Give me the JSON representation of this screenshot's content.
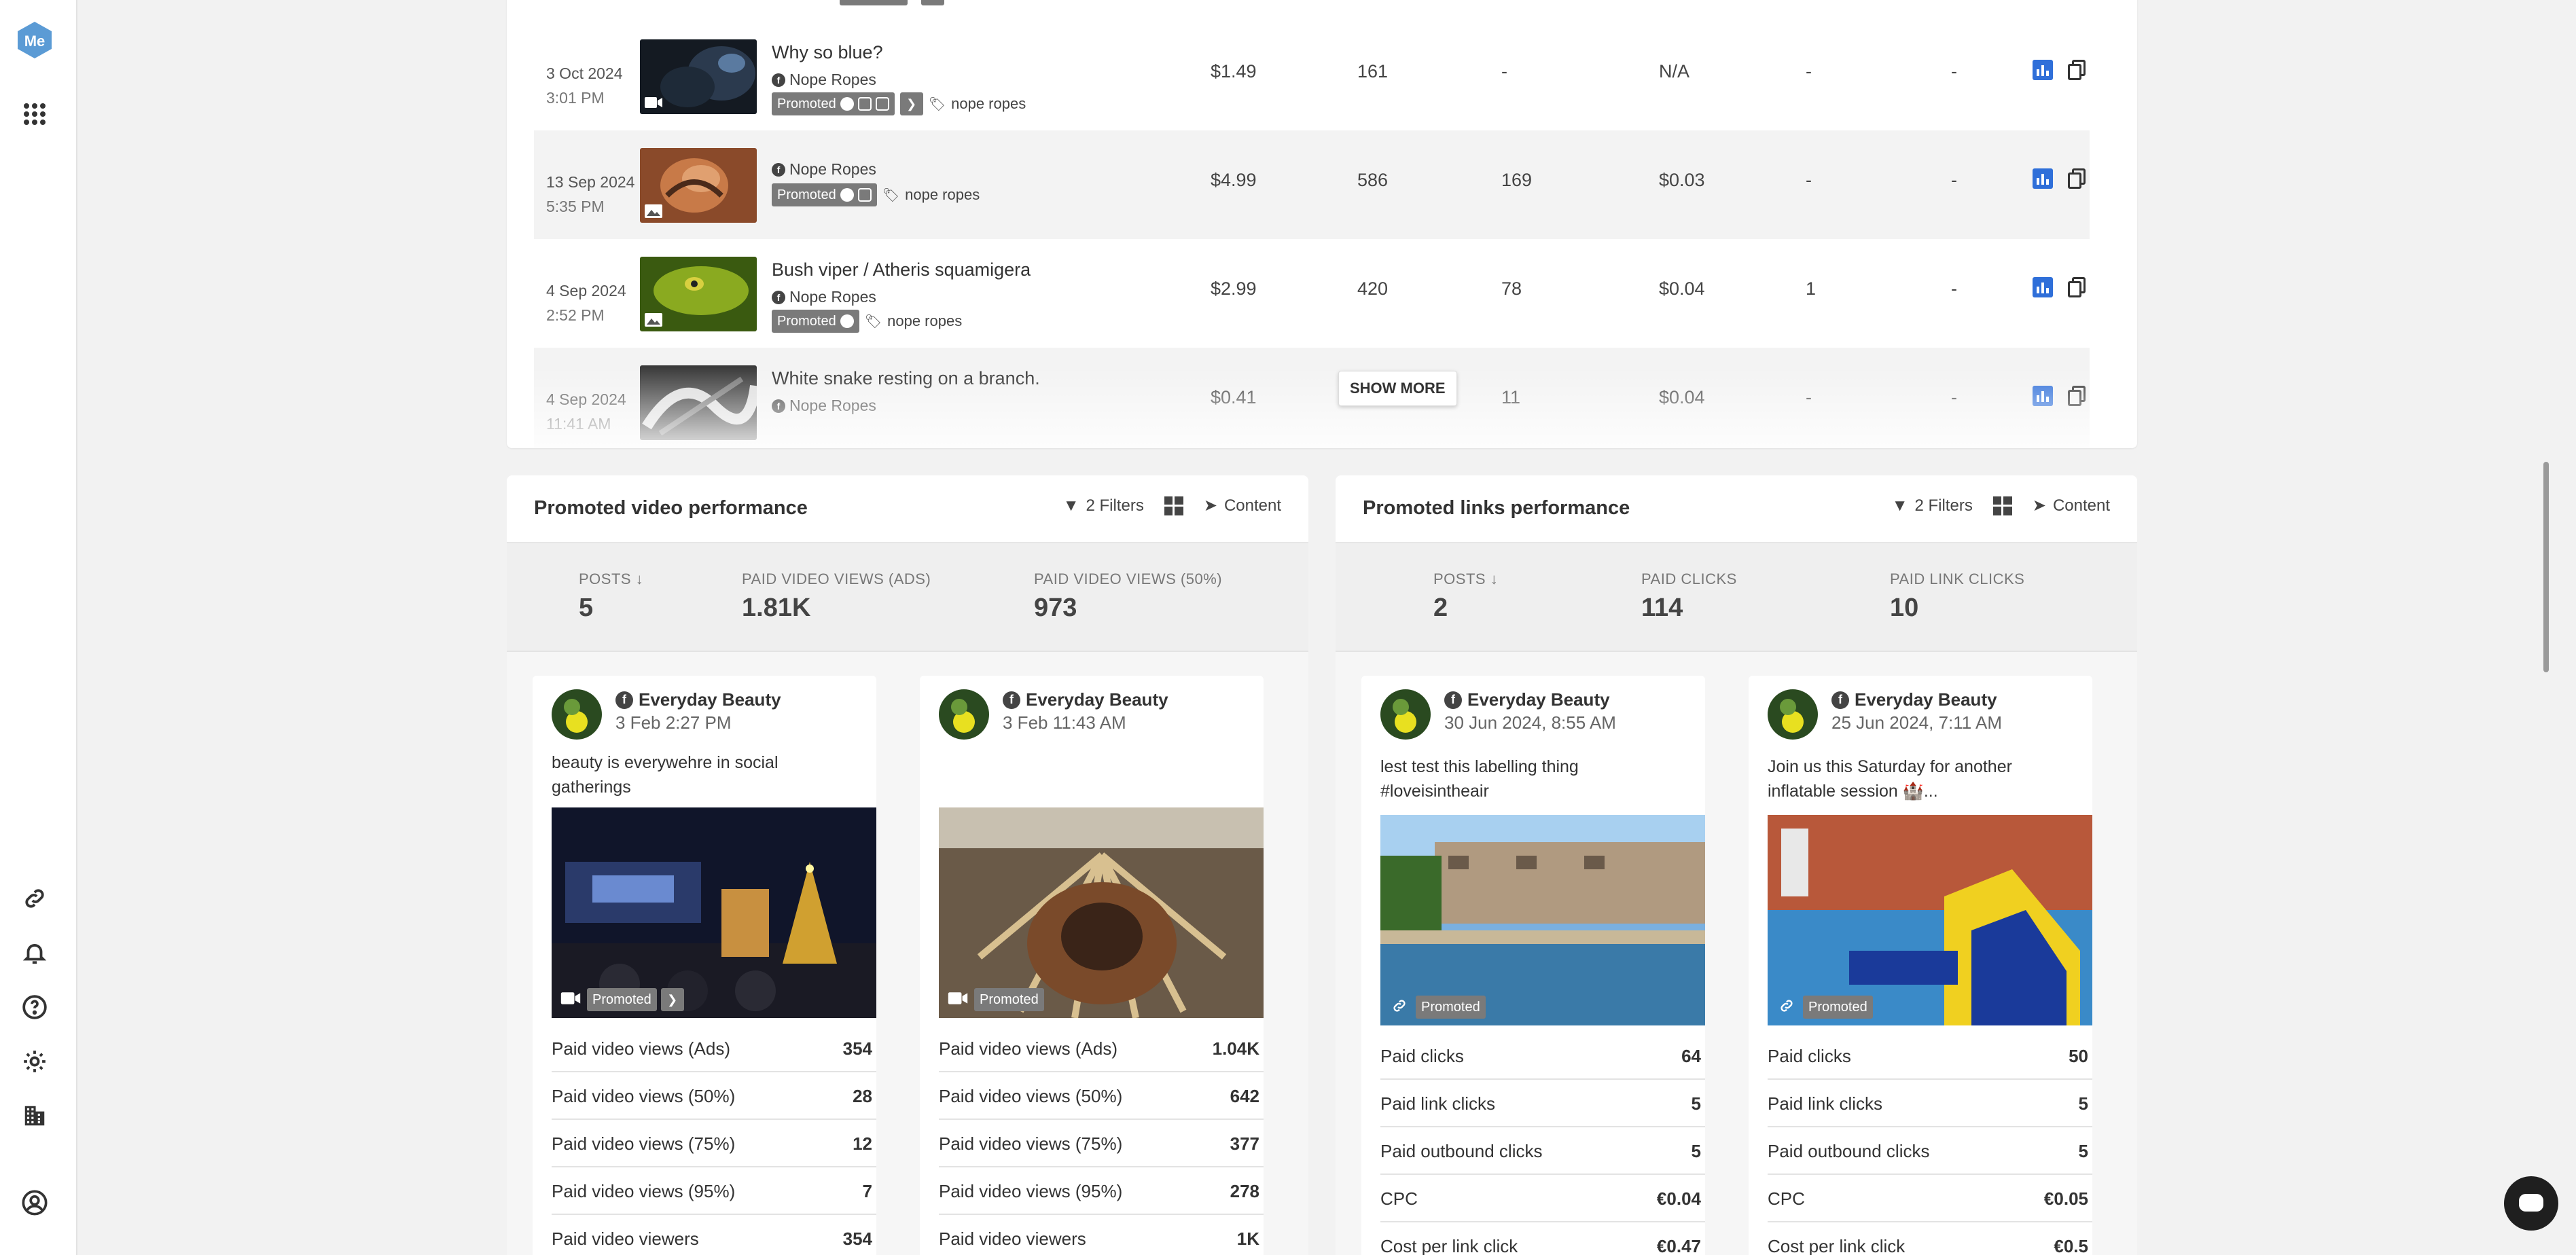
{
  "app": {
    "logo_text": "Me",
    "brand_color": "#5b9bd5"
  },
  "rail": {
    "top_icons": [
      "apps-grid-icon"
    ],
    "bottom_icons": [
      "link-icon",
      "bell-icon",
      "help-icon",
      "gear-icon",
      "building-icon",
      "account-icon"
    ]
  },
  "table": {
    "rows": [
      {
        "date": "3 Oct 2024",
        "time": "3:01 PM",
        "title": "Why so blue?",
        "profile": "Nope Ropes",
        "promoted": "Promoted",
        "tag": "nope ropes",
        "spend": "$1.49",
        "c2": "161",
        "c3": "-",
        "c4": "N/A",
        "c5": "-",
        "c6": "-"
      },
      {
        "date": "13 Sep 2024",
        "time": "5:35 PM",
        "title": "",
        "profile": "Nope Ropes",
        "promoted": "Promoted",
        "tag": "nope ropes",
        "spend": "$4.99",
        "c2": "586",
        "c3": "169",
        "c4": "$0.03",
        "c5": "-",
        "c6": "-"
      },
      {
        "date": "4 Sep 2024",
        "time": "2:52 PM",
        "title": "Bush viper / Atheris squamigera",
        "profile": "Nope Ropes",
        "promoted": "Promoted",
        "tag": "nope ropes",
        "spend": "$2.99",
        "c2": "420",
        "c3": "78",
        "c4": "$0.04",
        "c5": "1",
        "c6": "-"
      },
      {
        "date": "4 Sep 2024",
        "time": "11:41 AM",
        "title": "White snake resting on a branch.",
        "profile": "Nope Ropes",
        "promoted": "Promoted",
        "tag": "nope ropes",
        "spend": "$0.41",
        "c2": "",
        "c3": "11",
        "c4": "$0.04",
        "c5": "-",
        "c6": "-"
      }
    ],
    "show_more": "SHOW MORE"
  },
  "video_panel": {
    "title": "Promoted video performance",
    "filters": "2 Filters",
    "content": "Content",
    "metrics": [
      {
        "label": "POSTS",
        "value": "5"
      },
      {
        "label": "PAID VIDEO VIEWS (ADS)",
        "value": "1.81K"
      },
      {
        "label": "PAID VIDEO VIEWS (50%)",
        "value": "973"
      }
    ],
    "posts": [
      {
        "name": "Everyday Beauty",
        "date": "3 Feb 2:27 PM",
        "text": "beauty is everywehre in social gatherings",
        "badge": "Promoted",
        "stats": [
          {
            "label": "Paid video views (Ads)",
            "value": "354"
          },
          {
            "label": "Paid video views (50%)",
            "value": "28"
          },
          {
            "label": "Paid video views (75%)",
            "value": "12"
          },
          {
            "label": "Paid video views (95%)",
            "value": "7"
          },
          {
            "label": "Paid video viewers",
            "value": "354"
          }
        ]
      },
      {
        "name": "Everyday Beauty",
        "date": "3 Feb 11:43 AM",
        "text": "",
        "badge": "Promoted",
        "stats": [
          {
            "label": "Paid video views (Ads)",
            "value": "1.04K"
          },
          {
            "label": "Paid video views (50%)",
            "value": "642"
          },
          {
            "label": "Paid video views (75%)",
            "value": "377"
          },
          {
            "label": "Paid video views (95%)",
            "value": "278"
          },
          {
            "label": "Paid video viewers",
            "value": "1K"
          }
        ]
      }
    ]
  },
  "links_panel": {
    "title": "Promoted links performance",
    "filters": "2 Filters",
    "content": "Content",
    "metrics": [
      {
        "label": "POSTS",
        "value": "2"
      },
      {
        "label": "PAID CLICKS",
        "value": "114"
      },
      {
        "label": "PAID LINK CLICKS",
        "value": "10"
      }
    ],
    "posts": [
      {
        "name": "Everyday Beauty",
        "date": "30 Jun 2024, 8:55 AM",
        "text": "lest test this labelling thing #loveisintheair",
        "badge": "Promoted",
        "stats": [
          {
            "label": "Paid clicks",
            "value": "64"
          },
          {
            "label": "Paid link clicks",
            "value": "5"
          },
          {
            "label": "Paid outbound clicks",
            "value": "5"
          },
          {
            "label": "CPC",
            "value": "€0.04"
          },
          {
            "label": "Cost per link click",
            "value": "€0.47"
          }
        ]
      },
      {
        "name": "Everyday Beauty",
        "date": "25 Jun 2024, 7:11 AM",
        "text": "Join us this Saturday for another inflatable session 🏰...",
        "badge": "Promoted",
        "stats": [
          {
            "label": "Paid clicks",
            "value": "50"
          },
          {
            "label": "Paid link clicks",
            "value": "5"
          },
          {
            "label": "Paid outbound clicks",
            "value": "5"
          },
          {
            "label": "CPC",
            "value": "€0.05"
          },
          {
            "label": "Cost per link click",
            "value": "€0.5"
          }
        ]
      }
    ]
  }
}
